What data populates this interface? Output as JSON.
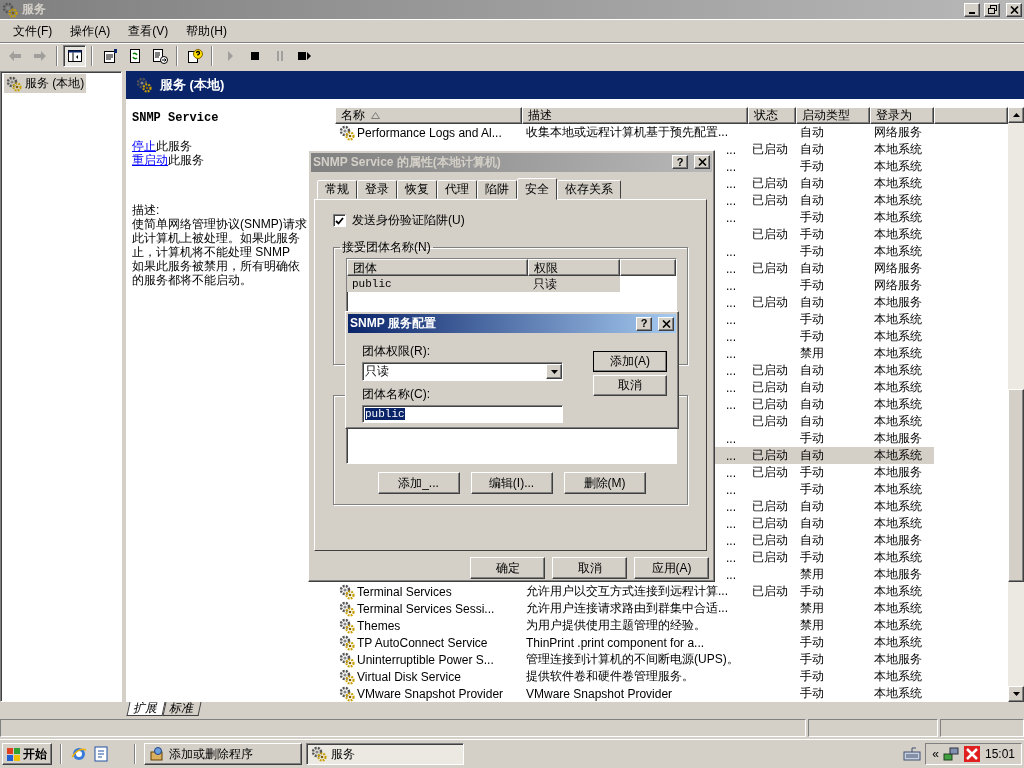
{
  "window": {
    "title": "服务"
  },
  "menu": [
    {
      "label": "文件(F)"
    },
    {
      "label": "操作(A)"
    },
    {
      "label": "查看(V)"
    },
    {
      "label": "帮助(H)"
    }
  ],
  "toolbar": [
    [
      {
        "kind": "back",
        "disabled": true,
        "pressed": false
      },
      {
        "kind": "forward",
        "disabled": true,
        "pressed": false
      }
    ],
    [
      {
        "kind": "tree",
        "disabled": false,
        "pressed": true
      }
    ],
    [
      {
        "kind": "properties",
        "disabled": false,
        "pressed": false
      },
      {
        "kind": "refresh",
        "disabled": false,
        "pressed": false
      },
      {
        "kind": "export",
        "disabled": false,
        "pressed": false
      }
    ],
    [
      {
        "kind": "help",
        "disabled": false,
        "pressed": false
      }
    ],
    [
      {
        "kind": "play",
        "disabled": true,
        "pressed": false
      },
      {
        "kind": "stop",
        "disabled": false,
        "pressed": false
      },
      {
        "kind": "pause",
        "disabled": true,
        "pressed": false
      },
      {
        "kind": "restart",
        "disabled": false,
        "pressed": false
      }
    ]
  ],
  "tree": {
    "items": [
      {
        "label": "服务 (本地)",
        "selected": true
      }
    ]
  },
  "pane": {
    "title": "服务 (本地)"
  },
  "detail": {
    "service_name": "SNMP Service",
    "actions": [
      {
        "link": "停止",
        "text": "此服务"
      },
      {
        "link": "重启动",
        "text": "此服务"
      }
    ],
    "description_label": "描述:",
    "description_lines": [
      "使简单网络管理协议(SNMP)请求",
      "此计算机上被处理。如果此服务",
      "止，计算机将不能处理 SNMP",
      "如果此服务被禁用，所有明确依",
      "的服务都将不能启动。"
    ]
  },
  "table": {
    "columns": [
      {
        "label": "名称",
        "sorted": true
      },
      {
        "label": "描述",
        "sorted": false
      },
      {
        "label": "状态",
        "sorted": false
      },
      {
        "label": "启动类型",
        "sorted": false
      },
      {
        "label": "登录为",
        "sorted": false
      }
    ],
    "rows": [
      {
        "name": "Performance Logs and Al...",
        "description": "收集本地或远程计算机基于预先配置...",
        "startup": "自动",
        "logon": "网络服务",
        "selected": false
      },
      {
        "description_tail": "...",
        "status": "已启动",
        "startup": "自动",
        "logon": "本地系统",
        "selected": false
      },
      {
        "description_tail": "...",
        "startup": "手动",
        "logon": "本地系统",
        "selected": false
      },
      {
        "description_tail": "...",
        "status": "已启动",
        "startup": "自动",
        "logon": "本地系统",
        "selected": false
      },
      {
        "description_tail": "...",
        "status": "已启动",
        "startup": "自动",
        "logon": "本地系统",
        "selected": false
      },
      {
        "description_tail": "...",
        "startup": "手动",
        "logon": "本地系统",
        "selected": false
      },
      {
        "status": "已启动",
        "startup": "手动",
        "logon": "本地系统",
        "selected": false
      },
      {
        "description_tail": "...",
        "startup": "手动",
        "logon": "本地系统",
        "selected": false
      },
      {
        "description_tail": "...",
        "status": "已启动",
        "startup": "自动",
        "logon": "网络服务",
        "selected": false
      },
      {
        "description_tail": "...",
        "startup": "手动",
        "logon": "网络服务",
        "selected": false
      },
      {
        "description_tail": "...",
        "status": "已启动",
        "startup": "自动",
        "logon": "本地服务",
        "selected": false
      },
      {
        "description_tail": "...",
        "startup": "手动",
        "logon": "本地系统",
        "selected": false
      },
      {
        "description_tail": "...",
        "startup": "手动",
        "logon": "本地系统",
        "selected": false
      },
      {
        "description_tail": "...",
        "startup": "禁用",
        "logon": "本地系统",
        "selected": false
      },
      {
        "description_tail": "...",
        "status": "已启动",
        "startup": "自动",
        "logon": "本地系统",
        "selected": false
      },
      {
        "description_tail": "...",
        "status": "已启动",
        "startup": "自动",
        "logon": "本地系统",
        "selected": false
      },
      {
        "description_tail": "...",
        "status": "已启动",
        "startup": "自动",
        "logon": "本地系统",
        "selected": false
      },
      {
        "status": "已启动",
        "startup": "自动",
        "logon": "本地系统",
        "selected": false
      },
      {
        "description_tail": "...",
        "startup": "手动",
        "logon": "本地服务",
        "selected": false
      },
      {
        "description_tail": "...",
        "status": "已启动",
        "startup": "自动",
        "logon": "本地系统",
        "selected": true
      },
      {
        "description_tail": "...",
        "status": "已启动",
        "startup": "手动",
        "logon": "本地服务",
        "selected": false
      },
      {
        "description_tail": "...",
        "startup": "手动",
        "logon": "本地系统",
        "selected": false
      },
      {
        "description_tail": "...",
        "status": "已启动",
        "startup": "自动",
        "logon": "本地系统",
        "selected": false
      },
      {
        "description_tail": "...",
        "status": "已启动",
        "startup": "自动",
        "logon": "本地系统",
        "selected": false
      },
      {
        "description_tail": "...",
        "status": "已启动",
        "startup": "自动",
        "logon": "本地服务",
        "selected": false
      },
      {
        "description_tail": "...",
        "status": "已启动",
        "startup": "手动",
        "logon": "本地系统",
        "selected": false
      },
      {
        "description_tail": "...",
        "startup": "禁用",
        "logon": "本地服务",
        "selected": false
      },
      {
        "name": "Terminal Services",
        "description": "允许用户以交互方式连接到远程计算...",
        "status": "已启动",
        "startup": "手动",
        "logon": "本地系统",
        "selected": false
      },
      {
        "name": "Terminal Services Sessi...",
        "description": "允许用户连接请求路由到群集中合适...",
        "startup": "禁用",
        "logon": "本地系统",
        "selected": false
      },
      {
        "name": "Themes",
        "description": "为用户提供使用主题管理的经验。",
        "startup": "禁用",
        "logon": "本地系统",
        "selected": false
      },
      {
        "name": "TP AutoConnect Service",
        "description": "ThinPrint .print component for a...",
        "startup": "手动",
        "logon": "本地系统",
        "selected": false
      },
      {
        "name": "Uninterruptible Power S...",
        "description": "管理连接到计算机的不间断电源(UPS)。",
        "startup": "手动",
        "logon": "本地服务",
        "selected": false
      },
      {
        "name": "Virtual Disk Service",
        "description": "提供软件卷和硬件卷管理服务。",
        "startup": "手动",
        "logon": "本地系统",
        "selected": false
      },
      {
        "name": "VMware Snapshot Provider",
        "description": "VMware Snapshot Provider",
        "startup": "手动",
        "logon": "本地系统",
        "selected": false
      }
    ]
  },
  "view_tabs": [
    {
      "label": "扩展",
      "selected": true
    },
    {
      "label": "标准",
      "selected": false
    }
  ],
  "properties_dialog": {
    "title": "SNMP Service 的属性(本地计算机)",
    "help_label": "?",
    "active": false,
    "tabs": [
      {
        "label": "常规",
        "selected": false
      },
      {
        "label": "登录",
        "selected": false
      },
      {
        "label": "恢复",
        "selected": false
      },
      {
        "label": "代理",
        "selected": false
      },
      {
        "label": "陷阱",
        "selected": false
      },
      {
        "label": "安全",
        "selected": true
      },
      {
        "label": "依存关系",
        "selected": false
      }
    ],
    "trap_checkbox": {
      "label": "发送身份验证陷阱(U)",
      "checked": true
    },
    "communities": {
      "label": "接受团体名称(N)",
      "columns": [
        "团体",
        "权限"
      ],
      "rows": [
        {
          "community": "public",
          "rights": "只读",
          "selected": true
        }
      ]
    },
    "host_buttons": [
      "添加_...",
      "编辑(I)...",
      "删除(M)"
    ],
    "buttons": [
      "确定",
      "取消",
      "应用(A)"
    ]
  },
  "config_dialog": {
    "title": "SNMP 服务配置",
    "help_label": "?",
    "active": true,
    "rights_label": "团体权限(R):",
    "rights_value": "只读",
    "name_label": "团体名称(C):",
    "name_value": "public",
    "name_value_selected": true,
    "buttons": [
      {
        "label": "添加(A)",
        "default": true
      },
      {
        "label": "取消",
        "default": false
      }
    ]
  },
  "taskbar": {
    "start": "开始",
    "tasks": [
      {
        "kind": "programs",
        "label": "添加或删除程序",
        "selected": false
      },
      {
        "kind": "services",
        "label": "服务",
        "selected": true
      }
    ],
    "tray_toggle": "«",
    "clock": "15:01"
  }
}
